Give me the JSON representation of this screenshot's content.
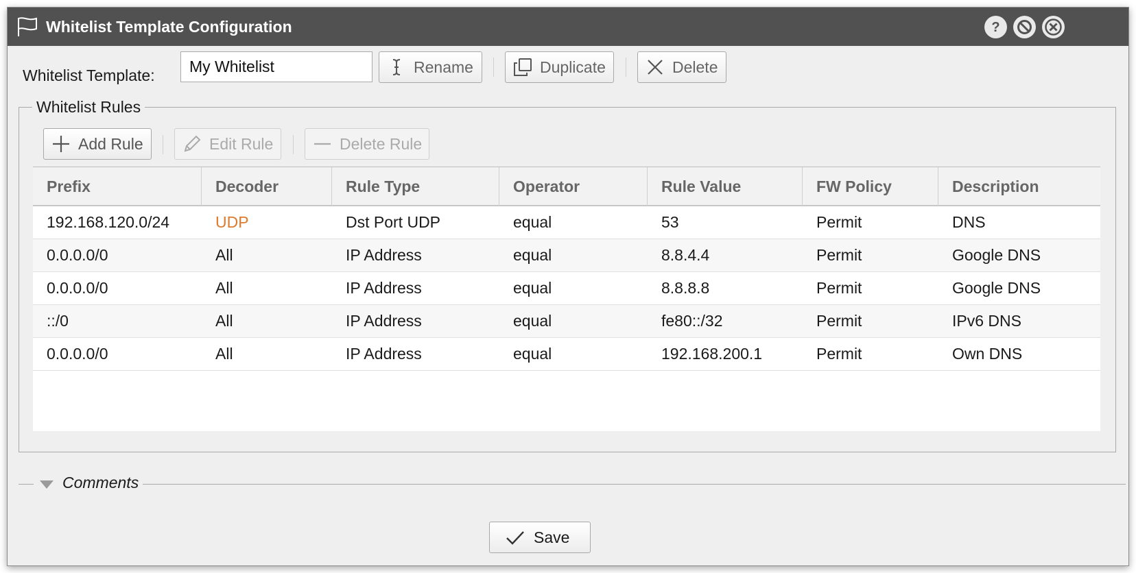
{
  "window": {
    "title": "Whitelist Template Configuration",
    "buttons": [
      "help-icon",
      "minimize-icon",
      "close-icon"
    ]
  },
  "template": {
    "label": "Whitelist Template:",
    "value": "My Whitelist",
    "rename_label": "Rename",
    "duplicate_label": "Duplicate",
    "delete_label": "Delete"
  },
  "rules": {
    "legend": "Whitelist Rules",
    "add_label": "Add Rule",
    "edit_label": "Edit Rule",
    "delete_label": "Delete Rule",
    "columns": [
      "Prefix",
      "Decoder",
      "Rule Type",
      "Operator",
      "Rule Value",
      "FW Policy",
      "Description"
    ],
    "rows": [
      [
        "192.168.120.0/24",
        "UDP",
        "Dst Port UDP",
        "equal",
        "53",
        "Permit",
        "DNS"
      ],
      [
        "0.0.0.0/0",
        "All",
        "IP Address",
        "equal",
        "8.8.4.4",
        "Permit",
        "Google DNS"
      ],
      [
        "0.0.0.0/0",
        "All",
        "IP Address",
        "equal",
        "8.8.8.8",
        "Permit",
        "Google DNS"
      ],
      [
        "::/0",
        "All",
        "IP Address",
        "equal",
        "fe80::/32",
        "Permit",
        "IPv6 DNS"
      ],
      [
        "0.0.0.0/0",
        "All",
        "IP Address",
        "equal",
        "192.168.200.1",
        "Permit",
        "Own DNS"
      ]
    ]
  },
  "comments": {
    "label": "Comments"
  },
  "footer": {
    "save_label": "Save"
  },
  "colors": {
    "titlebar": "#515151",
    "udp_accent": "#e07a2c",
    "panel_bg": "#efefef"
  }
}
